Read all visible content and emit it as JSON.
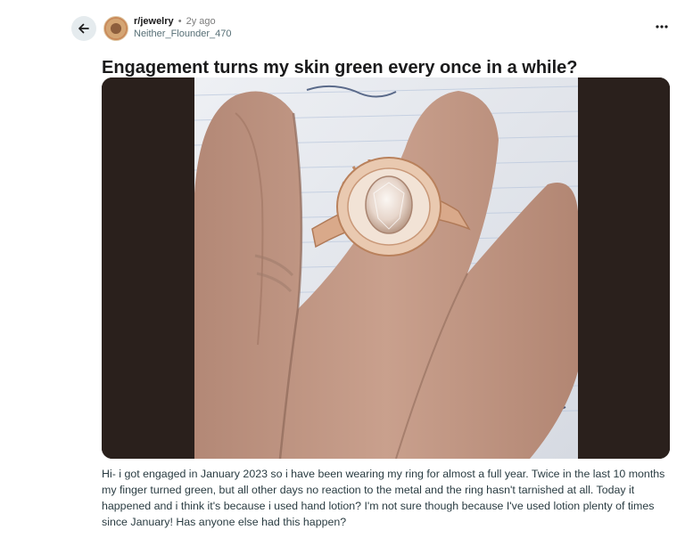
{
  "post": {
    "subreddit": "r/jewelry",
    "separator": "•",
    "time_ago": "2y ago",
    "author": "Neither_Flounder_470",
    "title": "Engagement turns my skin green every once in a while?",
    "body": "Hi- i got engaged in January 2023 so i have been wearing my ring for almost a full year. Twice in the last 10 months my finger turned green, but all other days no reaction to the metal and the ring hasn't tarnished at all. Today it happened and i think it's because i used hand lotion? I'm not sure though because I've used lotion plenty of times since January! Has anyone else had this happen?"
  },
  "icons": {
    "back": "arrow-left-icon",
    "more": "more-horizontal-icon",
    "avatar": "subreddit-avatar"
  }
}
